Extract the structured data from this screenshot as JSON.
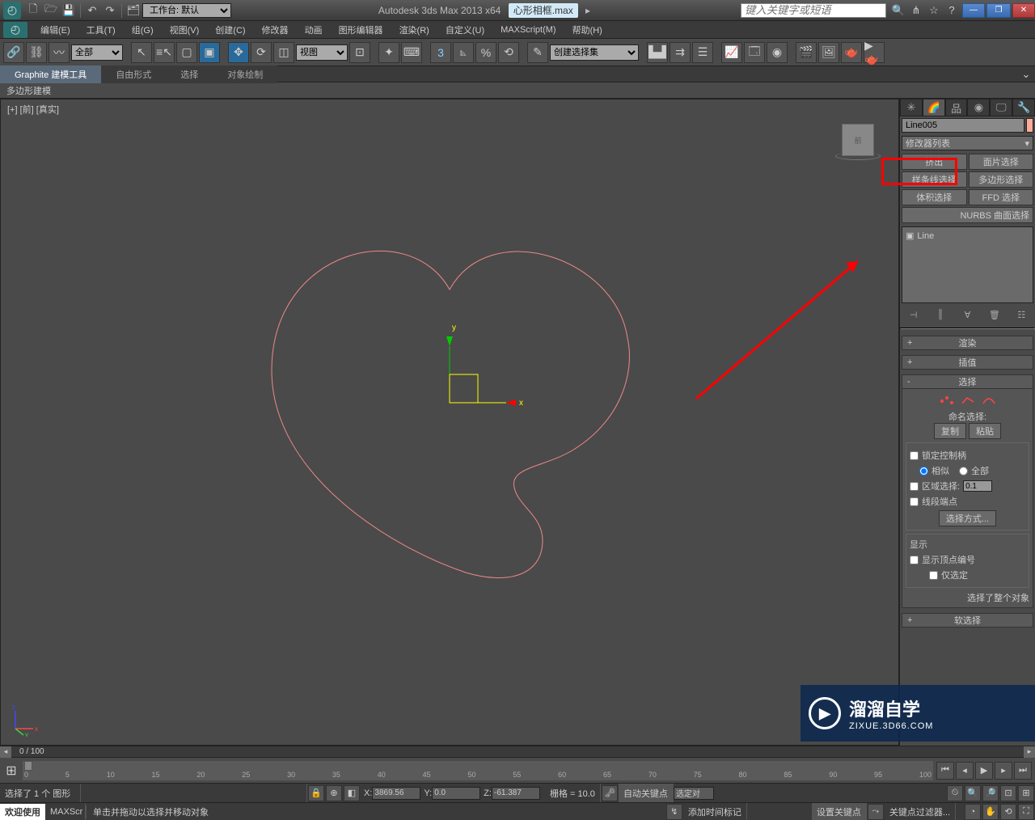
{
  "titlebar": {
    "workspace_label": "工作台: 默认",
    "app_title": "Autodesk 3ds Max  2013 x64",
    "file_name": "心形相框.max",
    "search_placeholder": "键入关键字或短语"
  },
  "menus": [
    "编辑(E)",
    "工具(T)",
    "组(G)",
    "视图(V)",
    "创建(C)",
    "修改器",
    "动画",
    "图形编辑器",
    "渲染(R)",
    "自定义(U)",
    "MAXScript(M)",
    "帮助(H)"
  ],
  "toolbar": {
    "filter_all": "全部",
    "view_label": "视图",
    "named_sets": "创建选择集"
  },
  "ribbon": {
    "tabs": [
      "Graphite 建模工具",
      "自由形式",
      "选择",
      "对象绘制"
    ],
    "panel_label": "多边形建模"
  },
  "viewport": {
    "label": "[+] [前] [真实]",
    "viewcube_face": "前",
    "axis_x": "x",
    "axis_y": "y",
    "axis_z": "z"
  },
  "cmdpanel": {
    "object_name": "Line005",
    "modifier_list_label": "修改器列表",
    "mod_buttons": [
      "挤出",
      "面片选择",
      "样条线选择",
      "多边形选择",
      "体积选择",
      "FFD 选择"
    ],
    "mod_nurbs": "NURBS 曲面选择",
    "stack_item": "Line",
    "rollouts": {
      "render": "渲染",
      "interpolation": "插值",
      "selection": "选择",
      "soft_select": "软选择"
    },
    "selection_body": {
      "named_label": "命名选择:",
      "copy_btn": "复制",
      "paste_btn": "粘贴",
      "lock_handles": "锁定控制柄",
      "similar": "相似",
      "all": "全部",
      "area_select": "区域选择:",
      "area_value": "0.1",
      "segment_end": "线段端点",
      "select_mode_btn": "选择方式...",
      "display_label": "显示",
      "show_vertex_num": "显示顶点编号",
      "only_selected": "仅选定",
      "whole_selected": "选择了整个对象"
    }
  },
  "timeline": {
    "frame_text": "0 / 100",
    "ticks": [
      "0",
      "5",
      "10",
      "15",
      "20",
      "25",
      "30",
      "35",
      "40",
      "45",
      "50",
      "55",
      "60",
      "65",
      "70",
      "75",
      "80",
      "85",
      "90",
      "95",
      "100"
    ]
  },
  "status": {
    "selection_text": "选择了 1 个 图形",
    "x_label": "X:",
    "x_val": "3869.56",
    "y_label": "Y:",
    "y_val": "0.0",
    "z_label": "Z:",
    "z_val": "-61.387",
    "grid_label": "栅格 = 10.0",
    "autokey": "自动关键点",
    "selset_dd": "选定对",
    "setkey": "设置关键点",
    "keyfilter": "关键点过滤器...",
    "welcome": "欢迎使用",
    "script": "MAXScr",
    "prompt": "单击并拖动以选择并移动对象",
    "addtime": "添加时间标记"
  },
  "watermark": {
    "brand": "溜溜自学",
    "url": "ZIXUE.3D66.COM"
  }
}
